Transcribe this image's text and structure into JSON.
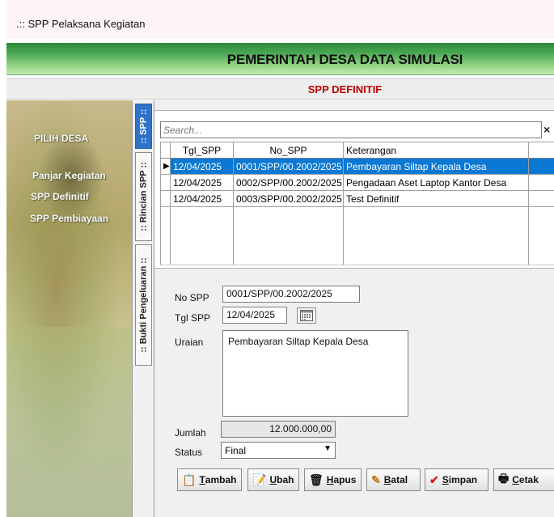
{
  "window": {
    "title": ".:: SPP Pelaksana Kegiatan"
  },
  "header": {
    "title": "PEMERINTAH DESA DATA SIMULASI",
    "subtitle": "SPP DEFINITIF"
  },
  "sidebar": {
    "items": [
      {
        "label": "PILIH DESA"
      },
      {
        "label": "Panjar Kegiatan"
      },
      {
        "label": "SPP Definitif"
      },
      {
        "label": "SPP Pembiayaan"
      }
    ]
  },
  "tabs": [
    {
      "label": ":: SPP ::",
      "active": true
    },
    {
      "label": ":: Rincian SPP ::",
      "active": false
    },
    {
      "label": ":: Bukti Pengeluaran ::",
      "active": false
    }
  ],
  "search": {
    "placeholder": "Search...",
    "clear": "×"
  },
  "grid": {
    "columns": [
      "Tgl_SPP",
      "No_SPP",
      "Keterangan"
    ],
    "rows": [
      {
        "tgl": "12/04/2025",
        "no": "0001/SPP/00.2002/2025",
        "ket": "Pembayaran Siltap Kepala Desa",
        "selected": true,
        "marker": "▶"
      },
      {
        "tgl": "12/04/2025",
        "no": "0002/SPP/00.2002/2025",
        "ket": "Pengadaan Aset Laptop Kantor Desa",
        "selected": false,
        "marker": ""
      },
      {
        "tgl": "12/04/2025",
        "no": "0003/SPP/00.2002/2025",
        "ket": "Test Definitif",
        "selected": false,
        "marker": ""
      }
    ]
  },
  "form": {
    "no_spp_label": "No SPP",
    "no_spp_value": "0001/SPP/00.2002/2025",
    "tgl_spp_label": "Tgl SPP",
    "tgl_spp_value": "12/04/2025",
    "uraian_label": "Uraian",
    "uraian_value": "Pembayaran Siltap Kepala Desa",
    "jumlah_label": "Jumlah",
    "jumlah_value": "12.000.000,00",
    "status_label": "Status",
    "status_value": "Final"
  },
  "buttons": [
    {
      "key": "T",
      "rest": "ambah",
      "icon": "add-document-icon"
    },
    {
      "key": "U",
      "rest": "bah",
      "icon": "edit-icon"
    },
    {
      "key": "H",
      "rest": "apus",
      "icon": "delete-icon"
    },
    {
      "key": "B",
      "rest": "atal",
      "icon": "cancel-icon"
    },
    {
      "key": "S",
      "rest": "impan",
      "icon": "checkmark-icon"
    },
    {
      "key": "C",
      "rest": "etak",
      "icon": "printer-icon"
    }
  ],
  "colors": {
    "accent": "#0b78d4",
    "subtitle": "#c00000",
    "header_green": "#47a551"
  }
}
